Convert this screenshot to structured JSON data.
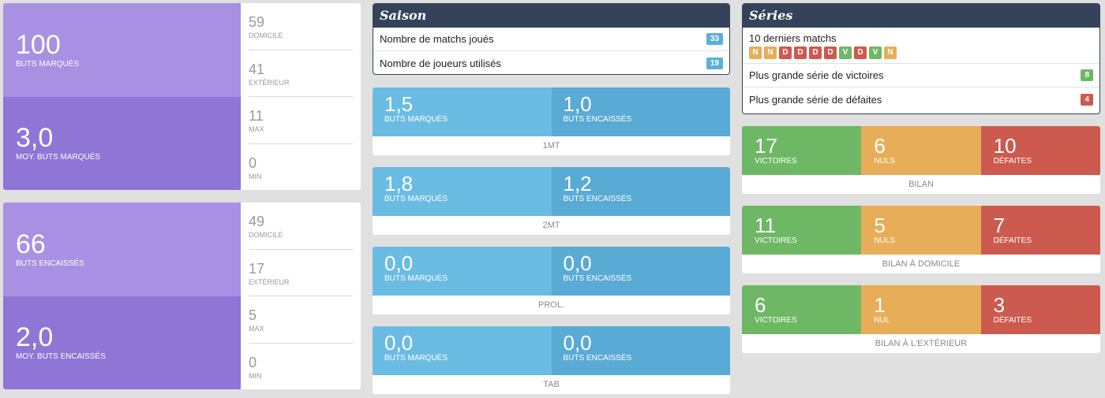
{
  "scored": {
    "total": "100",
    "total_label": "BUTS MARQUÉS",
    "avg": "3,0",
    "avg_label": "MOY. BUTS MARQUÉS",
    "stats": [
      {
        "value": "59",
        "label": "DOMICILE"
      },
      {
        "value": "41",
        "label": "EXTÉRIEUR"
      },
      {
        "value": "11",
        "label": "MAX"
      },
      {
        "value": "0",
        "label": "MIN"
      }
    ]
  },
  "conceded": {
    "total": "66",
    "total_label": "BUTS ENCAISSÉS",
    "avg": "2,0",
    "avg_label": "MOY. BUTS ENCAISSÉS",
    "stats": [
      {
        "value": "49",
        "label": "DOMICILE"
      },
      {
        "value": "17",
        "label": "EXTÉRIEUR"
      },
      {
        "value": "5",
        "label": "MAX"
      },
      {
        "value": "0",
        "label": "MIN"
      }
    ]
  },
  "saison": {
    "title": "Saison",
    "rows": [
      {
        "label": "Nombre de matchs joués",
        "value": "33"
      },
      {
        "label": "Nombre de joueurs utilisés",
        "value": "19"
      }
    ]
  },
  "periods": [
    {
      "scored": "1,5",
      "scored_label": "BUTS MARQUÉS",
      "conceded": "1,0",
      "conceded_label": "BUTS ENCAISSÉS",
      "footer": "1MT"
    },
    {
      "scored": "1,8",
      "scored_label": "BUTS MARQUÉS",
      "conceded": "1,2",
      "conceded_label": "BUTS ENCAISSÉS",
      "footer": "2MT"
    },
    {
      "scored": "0,0",
      "scored_label": "BUTS MARQUÉS",
      "conceded": "0,0",
      "conceded_label": "BUTS ENCAISSÉS",
      "footer": "PROL."
    },
    {
      "scored": "0,0",
      "scored_label": "BUTS MARQUÉS",
      "conceded": "0,0",
      "conceded_label": "BUTS ENCAISSÉS",
      "footer": "TAB"
    }
  ],
  "series": {
    "title": "Séries",
    "last_label": "10 derniers matchs",
    "last10": [
      "N",
      "N",
      "D",
      "D",
      "D",
      "D",
      "V",
      "D",
      "V",
      "N"
    ],
    "win_label": "Plus grande série de victoires",
    "win_value": "8",
    "loss_label": "Plus grande série de défaites",
    "loss_value": "4"
  },
  "bilans": [
    {
      "w": "17",
      "w_label": "VICTOIRES",
      "d": "6",
      "d_label": "NULS",
      "l": "10",
      "l_label": "DÉFAITES",
      "footer": "BILAN"
    },
    {
      "w": "11",
      "w_label": "VICTOIRES",
      "d": "5",
      "d_label": "NULS",
      "l": "7",
      "l_label": "DÉFAITES",
      "footer": "BILAN À DOMICILE"
    },
    {
      "w": "6",
      "w_label": "VICTOIRES",
      "d": "1",
      "d_label": "NUL",
      "l": "3",
      "l_label": "DÉFAITES",
      "footer": "BILAN À L'EXTÉRIEUR"
    }
  ],
  "colors": {
    "purple_light": "#a890e3",
    "purple_dark": "#8e75d6",
    "blue_light": "#6bbce3",
    "blue_dark": "#5aaad6",
    "navy": "#34425a",
    "win": "#6eb865",
    "draw": "#e8ad59",
    "loss": "#cd5a4e",
    "badge_blue": "#5bb0d8"
  }
}
